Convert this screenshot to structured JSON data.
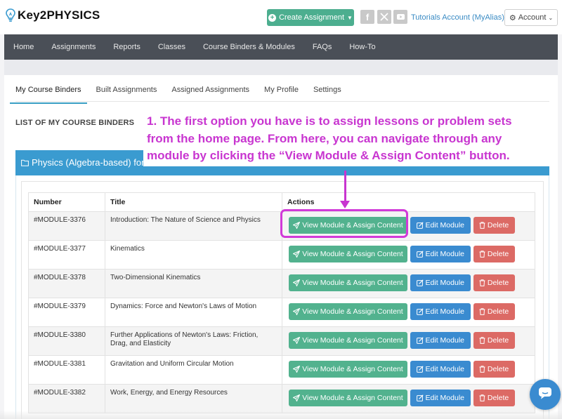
{
  "app": {
    "logo_text": "Key2PHYSICS"
  },
  "header": {
    "create_label": "Create Assignment",
    "tutorials_label": "Tutorials Account (MyAlias)",
    "account_label": "Account",
    "social_icons": [
      "facebook-icon",
      "x-icon",
      "youtube-icon"
    ]
  },
  "nav": {
    "items": [
      "Home",
      "Assignments",
      "Reports",
      "Classes",
      "Course Binders & Modules",
      "FAQs",
      "How-To"
    ]
  },
  "tabs": {
    "items": [
      "My Course Binders",
      "Built Assignments",
      "Assigned Assignments",
      "My Profile",
      "Settings"
    ],
    "active": "My Course Binders"
  },
  "list_heading": "LIST OF MY COURSE BINDERS",
  "binder": {
    "title": "Physics (Algebra-based) for"
  },
  "table": {
    "headers": [
      "Number",
      "Title",
      "Actions"
    ],
    "view_label": "View Module & Assign Content",
    "edit_label": "Edit Module",
    "delete_label": "Delete",
    "rows": [
      {
        "number": "#MODULE-3376",
        "title": "Introduction: The Nature of Science and Physics"
      },
      {
        "number": "#MODULE-3377",
        "title": "Kinematics"
      },
      {
        "number": "#MODULE-3378",
        "title": "Two-Dimensional Kinematics"
      },
      {
        "number": "#MODULE-3379",
        "title": "Dynamics: Force and Newton's Laws of Motion"
      },
      {
        "number": "#MODULE-3380",
        "title": "Further Applications of Newton's Laws: Friction, Drag, and Elasticity"
      },
      {
        "number": "#MODULE-3381",
        "title": "Gravitation and Uniform Circular Motion"
      },
      {
        "number": "#MODULE-3382",
        "title": "Work, Energy, and Energy Resources"
      }
    ]
  },
  "annotation": {
    "line1": "1. The first option you have is to assign lessons or problem sets",
    "line2": "from the home page. From here, you can navigate through any",
    "line3": "module by clicking the “View Module & Assign Content” button."
  },
  "colors": {
    "accent_green": "#4cae8f",
    "accent_blue": "#3a9bd0",
    "danger": "#dc6a65",
    "annotation": "#c835d0",
    "navbar": "#4a4f57"
  }
}
